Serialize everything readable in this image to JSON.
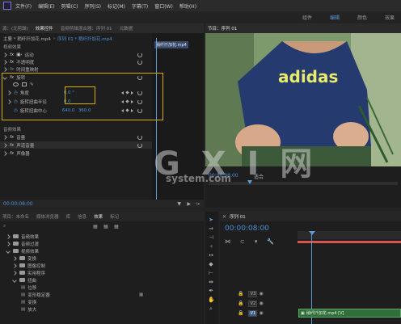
{
  "colors": {
    "accent": "#5b9bd5",
    "panel_bg": "#1e1e1e",
    "selection_outline": "#d4b000",
    "clip_green": "#2f6f3a",
    "playhead_red": "#d9534f"
  },
  "menubar": {
    "items": [
      "文件(F)",
      "编辑(E)",
      "剪辑(C)",
      "序列(S)",
      "标记(M)",
      "字幕(T)",
      "窗口(W)",
      "帮助(H)"
    ]
  },
  "workspaces": {
    "items": [
      "组件",
      "编辑",
      "颜色",
      "效果"
    ],
    "active": "编辑"
  },
  "effect_controls": {
    "tabs": [
      "源：(无剪辑)",
      "效果控件",
      "音频剪辑混合器：序列 01",
      "元数据"
    ],
    "header_master": "主要 * 稍纤扦加花.mp4",
    "header_seq": "序列 01 * 稍纤扦加花.mp4",
    "clip_badge": "稍纤扦加花.mp4",
    "section_video": "视频效果",
    "motion": "运动",
    "opacity": "不透明度",
    "time_remap": "时间重映射",
    "swirl": "旋转",
    "angle_label": "角度",
    "angle_value": "0.0 °",
    "radius_label": "旋转扭曲半径",
    "radius_value": "0.0",
    "center_label": "旋转扭曲中心",
    "center_x": "640.0",
    "center_y": "360.0",
    "section_audio": "音频效果",
    "volume": "音量",
    "channel_volume": "声道音量",
    "panner": "声像器",
    "timecode": "00:00:08:00"
  },
  "program": {
    "title": "节目：序列 01",
    "shirt_text": "adidas",
    "timecode": "00:00:08:00",
    "fit": "适合"
  },
  "watermark": {
    "main": "G X I 网",
    "sub": "system.com"
  },
  "project_panel": {
    "tabs": [
      "项目：未命名",
      "媒体浏览器",
      "库",
      "信息",
      "效果",
      "标记"
    ],
    "tree": [
      {
        "label": "音频效果",
        "level": 0,
        "open": false
      },
      {
        "label": "音频过渡",
        "level": 0,
        "open": false
      },
      {
        "label": "视频效果",
        "level": 0,
        "open": true
      },
      {
        "label": "变换",
        "level": 1,
        "open": false
      },
      {
        "label": "图像控制",
        "level": 1,
        "open": false
      },
      {
        "label": "实用程序",
        "level": 1,
        "open": false
      },
      {
        "label": "扭曲",
        "level": 1,
        "open": true
      },
      {
        "label": "位移",
        "level": 2,
        "open": false
      },
      {
        "label": "变形稳定器",
        "level": 2,
        "open": false
      },
      {
        "label": "变换",
        "level": 2,
        "open": false
      },
      {
        "label": "放大",
        "level": 2,
        "open": false
      }
    ]
  },
  "timeline": {
    "tab": "序列 01",
    "timecode": "00:00:08:00",
    "tracks": [
      "V3",
      "V2",
      "V1"
    ],
    "clip_label": "稍纤扦加花.mp4 [V]"
  }
}
